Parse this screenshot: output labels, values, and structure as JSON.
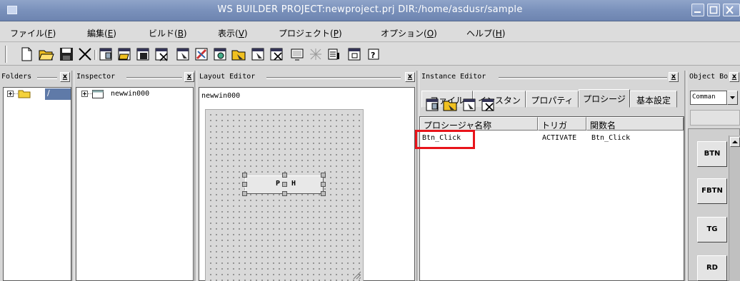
{
  "window": {
    "title": "WS BUILDER PROJECT:newproject.prj DIR:/home/asdusr/sample"
  },
  "menubar": [
    {
      "label": "ファイル(",
      "key": "F",
      "end": ")"
    },
    {
      "label": "編集(",
      "key": "E",
      "end": ")"
    },
    {
      "label": "ビルド(",
      "key": "B",
      "end": ")"
    },
    {
      "label": "表示(",
      "key": "V",
      "end": ")"
    },
    {
      "label": "プロジェクト(",
      "key": "P",
      "end": ")"
    },
    {
      "label": "オプション(",
      "key": "O",
      "end": ")"
    },
    {
      "label": "ヘルプ(",
      "key": "H",
      "end": ")"
    }
  ],
  "panels": {
    "folders": {
      "title": "Folders",
      "close": "x",
      "root_label": "/"
    },
    "inspector": {
      "title": "Inspector",
      "close": "x",
      "item": "newwin000"
    },
    "layout_editor": {
      "title": "Layout Editor",
      "close": "x",
      "window_name": "newwin000",
      "widget_label": "P",
      "widget_label2": "H"
    },
    "instance_editor": {
      "title": "Instance Editor",
      "close": "x",
      "tabs": [
        "ファイル",
        "インスタン",
        "プロパティ",
        "プロシージ",
        "基本設定"
      ],
      "active_tab": 3,
      "columns": [
        "プロシージャ名称",
        "トリガ",
        "関数名"
      ],
      "rows": [
        {
          "name": "Btn_Click",
          "trigger": "ACTIVATE",
          "function": "Btn_Click"
        }
      ],
      "highlight_color": "#e8141b"
    },
    "object_box": {
      "title": "Object Bo",
      "close": "x",
      "combo_value": "Comman",
      "buttons": [
        "BTN",
        "FBTN",
        "TG",
        "RD"
      ]
    }
  }
}
